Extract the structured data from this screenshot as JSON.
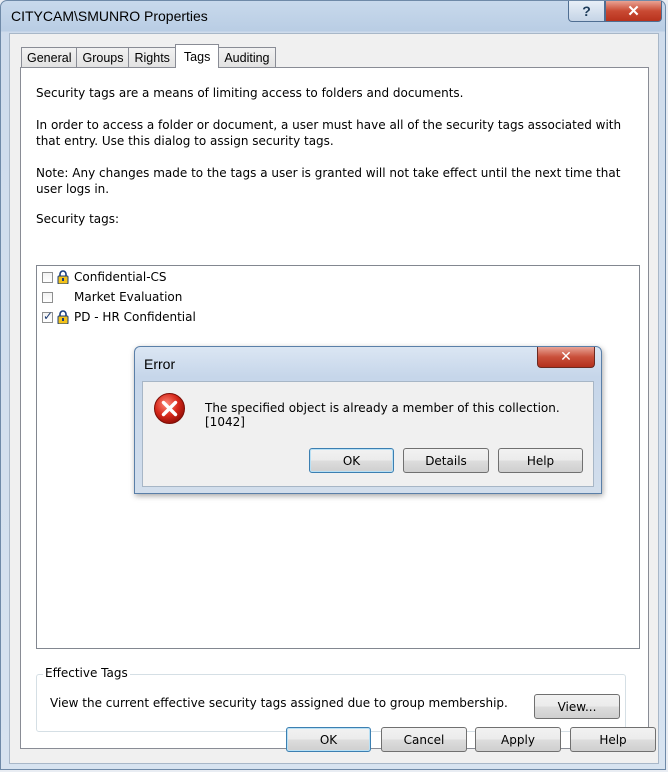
{
  "window": {
    "title": "CITYCAM\\SMUNRO Properties",
    "help_glyph": "?",
    "close_glyph": "✕"
  },
  "tabs": [
    "General",
    "Groups",
    "Rights",
    "Tags",
    "Auditing"
  ],
  "active_tab": "Tags",
  "tags_page": {
    "intro": "Security tags are a means of limiting access to folders and documents.",
    "explain": "In order to access a folder or document, a user must have all of the security tags associated with that entry. Use this dialog to assign security tags.",
    "note": "Note: Any changes made to the tags a user is granted will not take effect until the next time that user logs in.",
    "list_label": "Security tags:",
    "tags": [
      {
        "name": "Confidential-CS",
        "checked": false
      },
      {
        "name": "Market Evaluation",
        "checked": false
      },
      {
        "name": "PD - HR Confidential",
        "checked": true
      }
    ],
    "effective": {
      "legend": "Effective Tags",
      "text": "View the current effective security tags assigned due to group membership.",
      "view_button": "View..."
    }
  },
  "footer": {
    "ok": "OK",
    "cancel": "Cancel",
    "apply": "Apply",
    "help": "Help"
  },
  "error_dialog": {
    "title": "Error",
    "close_glyph": "✕",
    "message": "The specified object is already a member of this collection. [1042]",
    "icon": "error-icon",
    "ok": "OK",
    "details": "Details",
    "help": "Help"
  }
}
